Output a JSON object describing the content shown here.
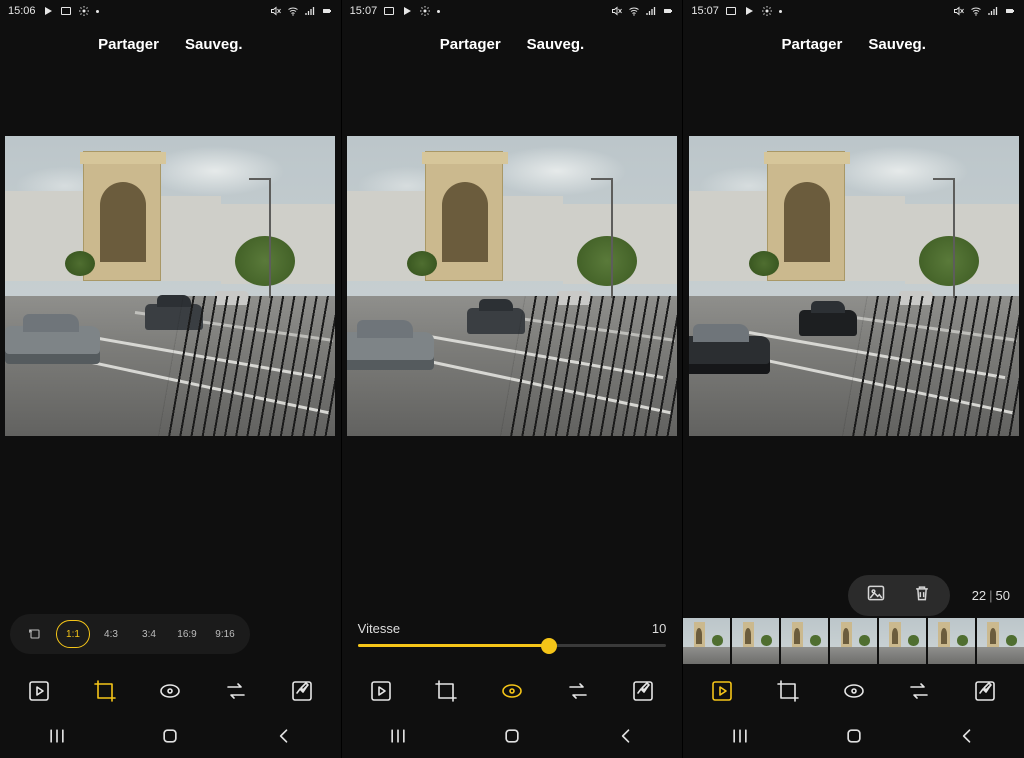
{
  "panes": [
    {
      "status": {
        "time": "15:06"
      },
      "actions": {
        "share": "Partager",
        "save": "Sauveg."
      },
      "aspect": {
        "options": [
          "1:1",
          "4:3",
          "3:4",
          "16:9",
          "9:16"
        ],
        "selected": "1:1"
      },
      "tools_selected": "crop"
    },
    {
      "status": {
        "time": "15:07"
      },
      "actions": {
        "share": "Partager",
        "save": "Sauveg."
      },
      "speed": {
        "label": "Vitesse",
        "value": "10",
        "percent": 62
      },
      "tools_selected": "speed"
    },
    {
      "status": {
        "time": "15:07"
      },
      "actions": {
        "share": "Partager",
        "save": "Sauveg."
      },
      "frame_counter": {
        "current": "22",
        "total": "50"
      },
      "filmstrip": {
        "count": 7,
        "selected_index": 3
      },
      "tools_selected": "play"
    }
  ]
}
